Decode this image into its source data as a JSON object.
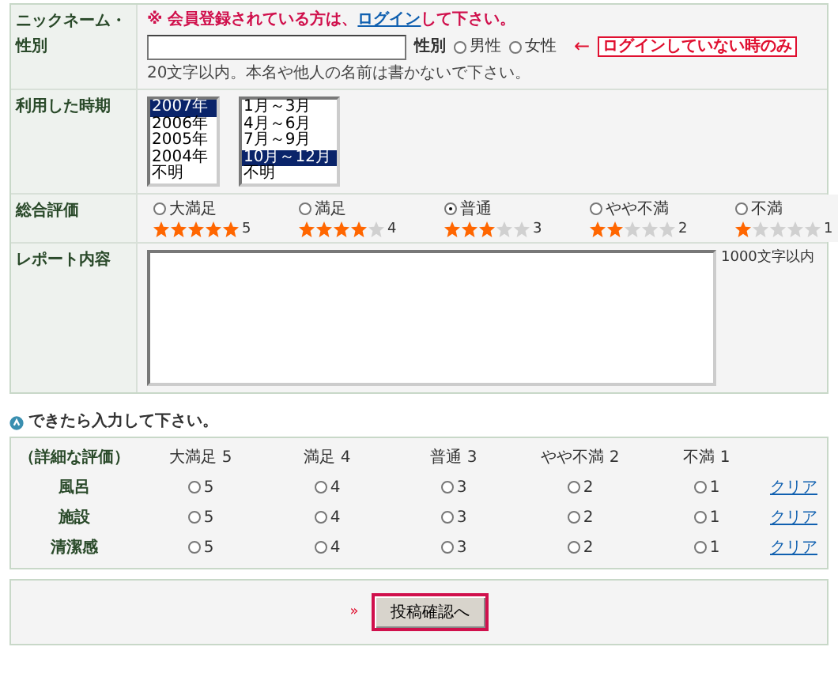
{
  "nickname": {
    "label_lines": [
      "ニックネーム・",
      "性別"
    ],
    "notice_before": "※ 会員登録されている方は、",
    "login_link": "ログイン",
    "notice_after": "して下さい。",
    "gender_label": "性別",
    "gender_options": [
      {
        "label": "男性",
        "selected": false
      },
      {
        "label": "女性",
        "selected": false
      }
    ],
    "annotation_arrow": "←",
    "annotation": "ログインしていない時のみ",
    "hint": "20文字以内。本名や他人の名前は書かないで下さい。"
  },
  "period": {
    "label": "利用した時期",
    "years": [
      {
        "label": "2007年",
        "selected": true
      },
      {
        "label": "2006年",
        "selected": false
      },
      {
        "label": "2005年",
        "selected": false
      },
      {
        "label": "2004年",
        "selected": false
      },
      {
        "label": "不明",
        "selected": false
      }
    ],
    "months": [
      {
        "label": "1月～3月",
        "selected": false
      },
      {
        "label": "4月～6月",
        "selected": false
      },
      {
        "label": "7月～9月",
        "selected": false
      },
      {
        "label": "10月～12月",
        "selected": true
      },
      {
        "label": "不明",
        "selected": false
      }
    ]
  },
  "overall": {
    "label": "総合評価",
    "options": [
      {
        "label": "大満足",
        "stars": 5,
        "score": "5",
        "selected": false
      },
      {
        "label": "満足",
        "stars": 4,
        "score": "4",
        "selected": false
      },
      {
        "label": "普通",
        "stars": 3,
        "score": "3",
        "selected": true
      },
      {
        "label": "やや不満",
        "stars": 2,
        "score": "2",
        "selected": false
      },
      {
        "label": "不満",
        "stars": 1,
        "score": "1",
        "selected": false
      }
    ]
  },
  "report": {
    "label": "レポート内容",
    "note": "1000文字以内"
  },
  "optional_note": "できたら入力して下さい。",
  "detail": {
    "header_label": "（詳細な評価）",
    "columns": [
      "大満足 5",
      "満足 4",
      "普通 3",
      "やや不満 2",
      "不満 1"
    ],
    "rows": [
      {
        "label": "風呂",
        "clear": "クリア",
        "options": [
          {
            "value": "5",
            "selected": false
          },
          {
            "value": "4",
            "selected": false
          },
          {
            "value": "3",
            "selected": false
          },
          {
            "value": "2",
            "selected": false
          },
          {
            "value": "1",
            "selected": false
          }
        ]
      },
      {
        "label": "施設",
        "clear": "クリア",
        "options": [
          {
            "value": "5",
            "selected": false
          },
          {
            "value": "4",
            "selected": false
          },
          {
            "value": "3",
            "selected": false
          },
          {
            "value": "2",
            "selected": false
          },
          {
            "value": "1",
            "selected": false
          }
        ]
      },
      {
        "label": "清潔感",
        "clear": "クリア",
        "options": [
          {
            "value": "5",
            "selected": false
          },
          {
            "value": "4",
            "selected": false
          },
          {
            "value": "3",
            "selected": false
          },
          {
            "value": "2",
            "selected": false
          },
          {
            "value": "1",
            "selected": false
          }
        ]
      }
    ]
  },
  "submit": {
    "marker": "»",
    "button": "投稿確認へ"
  }
}
